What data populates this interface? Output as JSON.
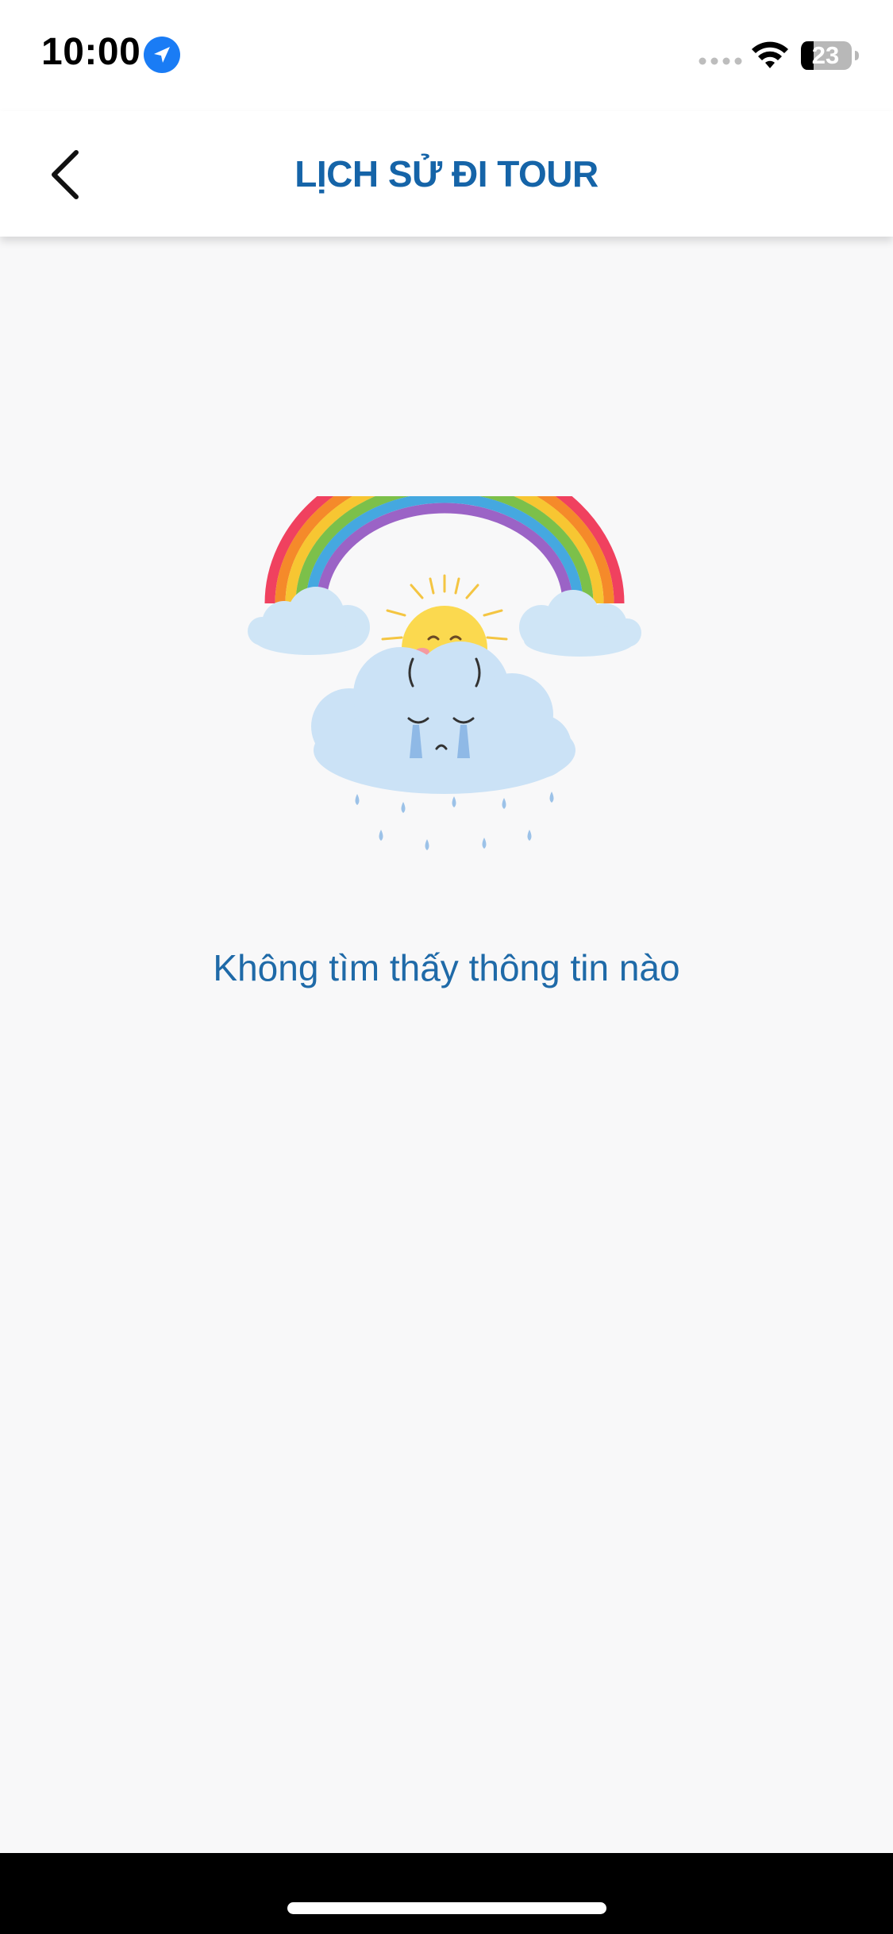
{
  "status_bar": {
    "time": "10:00",
    "battery": "23",
    "icons": [
      "location-arrow-icon",
      "signal-icon",
      "wifi-icon",
      "battery-icon"
    ]
  },
  "header": {
    "title": "LỊCH SỬ ĐI TOUR",
    "back_icon": "chevron-left-icon",
    "title_color": "#1564a8"
  },
  "empty_state": {
    "illustration": "crying-cloud-rainbow-sun",
    "message": "Không tìm thấy thông tin nào",
    "message_color": "#1f6aa8"
  }
}
